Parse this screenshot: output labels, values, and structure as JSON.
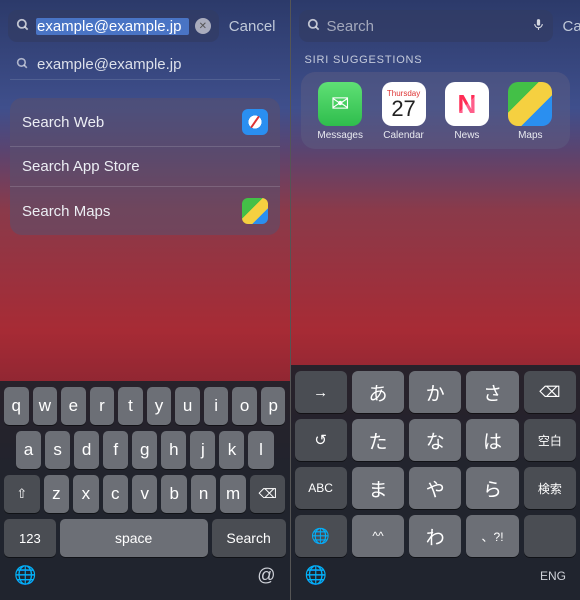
{
  "left": {
    "search": {
      "value": "example@example.jp",
      "cancel": "Cancel"
    },
    "suggestion": "example@example.jp",
    "actions": {
      "web": "Search Web",
      "appstore": "Search App Store",
      "maps": "Search Maps"
    },
    "keyboard": {
      "row1": [
        "q",
        "w",
        "e",
        "r",
        "t",
        "y",
        "u",
        "i",
        "o",
        "p"
      ],
      "row2": [
        "a",
        "s",
        "d",
        "f",
        "g",
        "h",
        "j",
        "k",
        "l"
      ],
      "row3": [
        "z",
        "x",
        "c",
        "v",
        "b",
        "n",
        "m"
      ],
      "shift": "⇧",
      "backspace": "⌫",
      "numkey": "123",
      "space": "space",
      "search": "Search",
      "globe": "🌐",
      "at": "@"
    }
  },
  "right": {
    "search": {
      "placeholder": "Search",
      "cancel": "Cancel"
    },
    "siri_header": "SIRI SUGGESTIONS",
    "apps": {
      "messages": "Messages",
      "calendar": {
        "label": "Calendar",
        "weekday": "Thursday",
        "day": "27"
      },
      "news": "News",
      "maps": "Maps"
    },
    "keyboard": {
      "row1_fn": [
        "→",
        "⌫"
      ],
      "row1": [
        "あ",
        "か",
        "さ"
      ],
      "row2_fn": [
        "↺",
        "空白"
      ],
      "row2": [
        "た",
        "な",
        "は"
      ],
      "row3_fn_l": "ABC",
      "row3_fn_r": "検索",
      "row3": [
        "ま",
        "や",
        "ら"
      ],
      "row4_fn": "🌐",
      "row4": [
        "^^",
        "わ",
        "、?!"
      ],
      "row4_blank": "",
      "bottom_lang": "ENG"
    }
  }
}
